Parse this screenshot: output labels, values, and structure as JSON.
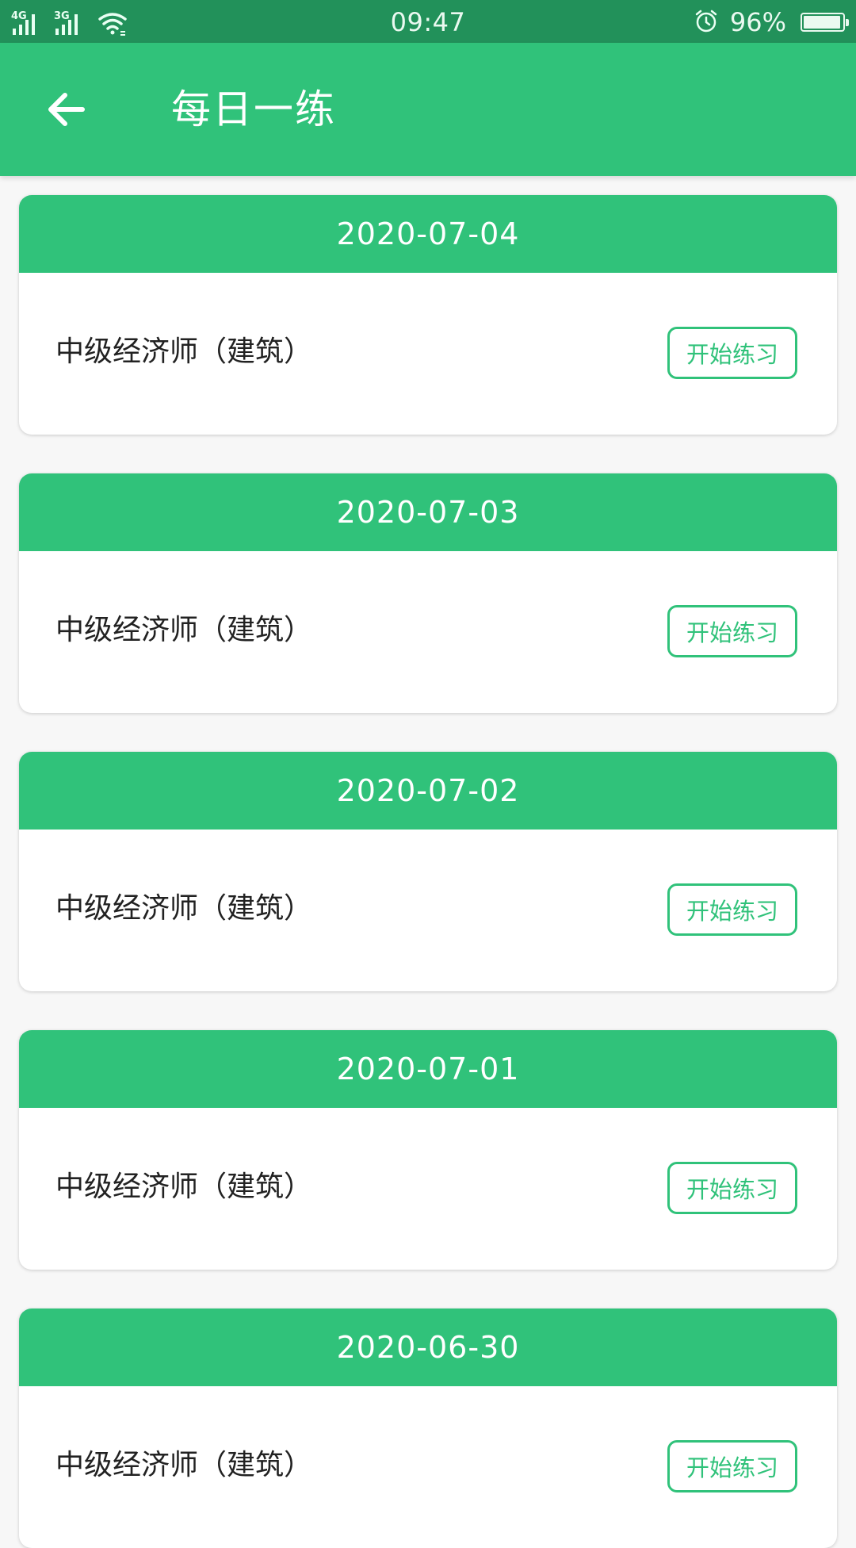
{
  "status_bar": {
    "network_1": "4G",
    "network_2": "3G",
    "time": "09:47",
    "battery_percent": "96%",
    "battery_level": 0.96,
    "icons": [
      "signal-icon",
      "wifi-icon",
      "alarm-icon",
      "battery-icon"
    ]
  },
  "app_bar": {
    "title": "每日一练",
    "back_icon": "arrow-left-icon"
  },
  "colors": {
    "primary": "#30c27a",
    "status_bar": "#22915a",
    "text": "#222222",
    "background": "#f7f7f7"
  },
  "practice_list": [
    {
      "date": "2020-07-04",
      "subject": "中级经济师（建筑）",
      "button_label": "开始练习"
    },
    {
      "date": "2020-07-03",
      "subject": "中级经济师（建筑）",
      "button_label": "开始练习"
    },
    {
      "date": "2020-07-02",
      "subject": "中级经济师（建筑）",
      "button_label": "开始练习"
    },
    {
      "date": "2020-07-01",
      "subject": "中级经济师（建筑）",
      "button_label": "开始练习"
    },
    {
      "date": "2020-06-30",
      "subject": "中级经济师（建筑）",
      "button_label": "开始练习"
    }
  ]
}
